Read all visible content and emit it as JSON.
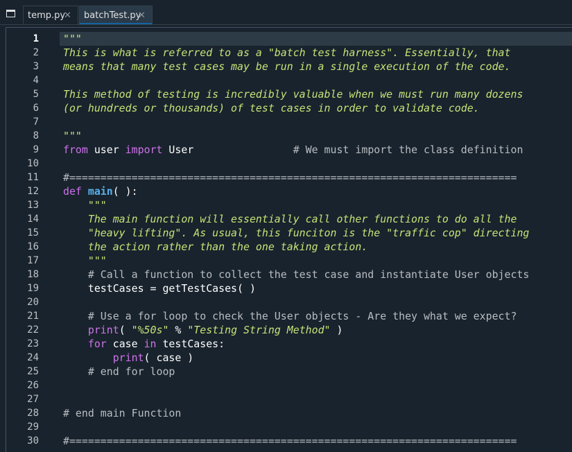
{
  "tabs": [
    {
      "label": "temp.py",
      "close": "✕",
      "active": false
    },
    {
      "label": "batchTest.py",
      "close": "✕",
      "active": true
    }
  ],
  "editor": {
    "current_line": 1,
    "lines": [
      {
        "n": "1",
        "segments": [
          {
            "c": "doc",
            "t": "\"\"\""
          }
        ]
      },
      {
        "n": "2",
        "segments": [
          {
            "c": "doc",
            "t": "This is what is referred to as a \"batch test harness\". Essentially, that"
          }
        ]
      },
      {
        "n": "3",
        "segments": [
          {
            "c": "doc",
            "t": "means that many test cases may be run in a single execution of the code."
          }
        ]
      },
      {
        "n": "4",
        "segments": []
      },
      {
        "n": "5",
        "segments": [
          {
            "c": "doc",
            "t": "This method of testing is incredibly valuable when we must run many dozens"
          }
        ]
      },
      {
        "n": "6",
        "segments": [
          {
            "c": "doc",
            "t": "(or hundreds or thousands) of test cases in order to validate code."
          }
        ]
      },
      {
        "n": "7",
        "segments": []
      },
      {
        "n": "8",
        "segments": [
          {
            "c": "doc",
            "t": "\"\"\""
          }
        ]
      },
      {
        "n": "9",
        "segments": [
          {
            "c": "kw",
            "t": "from"
          },
          {
            "c": "plain",
            "t": " user "
          },
          {
            "c": "kw",
            "t": "import"
          },
          {
            "c": "plain",
            "t": " User                "
          },
          {
            "c": "cm",
            "t": "# We must import the class definition"
          }
        ]
      },
      {
        "n": "10",
        "segments": []
      },
      {
        "n": "11",
        "segments": [
          {
            "c": "cm",
            "t": "#========================================================================"
          }
        ]
      },
      {
        "n": "12",
        "segments": [
          {
            "c": "kw",
            "t": "def"
          },
          {
            "c": "plain",
            "t": " "
          },
          {
            "c": "fn",
            "t": "main"
          },
          {
            "c": "plain",
            "t": "( ):"
          }
        ]
      },
      {
        "n": "13",
        "segments": [
          {
            "c": "doc",
            "t": "    \"\"\""
          }
        ]
      },
      {
        "n": "14",
        "segments": [
          {
            "c": "doc",
            "t": "    The main function will essentially call other functions to do all the"
          }
        ]
      },
      {
        "n": "15",
        "segments": [
          {
            "c": "doc",
            "t": "    \"heavy lifting\". As usual, this funciton is the \"traffic cop\" directing"
          }
        ]
      },
      {
        "n": "16",
        "segments": [
          {
            "c": "doc",
            "t": "    the action rather than the one taking action."
          }
        ]
      },
      {
        "n": "17",
        "segments": [
          {
            "c": "doc",
            "t": "    \"\"\""
          }
        ]
      },
      {
        "n": "18",
        "segments": [
          {
            "c": "cm",
            "t": "    # Call a function to collect the test case and instantiate User objects"
          }
        ]
      },
      {
        "n": "19",
        "segments": [
          {
            "c": "plain",
            "t": "    testCases = getTestCases( )"
          }
        ]
      },
      {
        "n": "20",
        "segments": []
      },
      {
        "n": "21",
        "segments": [
          {
            "c": "cm",
            "t": "    # Use a for loop to check the User objects - Are they what we expect?"
          }
        ]
      },
      {
        "n": "22",
        "segments": [
          {
            "c": "kw",
            "t": "    print"
          },
          {
            "c": "plain",
            "t": "( "
          },
          {
            "c": "str",
            "t": "\"%50s\""
          },
          {
            "c": "plain",
            "t": " % "
          },
          {
            "c": "str",
            "t": "\"Testing String Method\""
          },
          {
            "c": "plain",
            "t": " )"
          }
        ]
      },
      {
        "n": "23",
        "segments": [
          {
            "c": "kw",
            "t": "    for"
          },
          {
            "c": "plain",
            "t": " case "
          },
          {
            "c": "kw",
            "t": "in"
          },
          {
            "c": "plain",
            "t": " testCases:"
          }
        ]
      },
      {
        "n": "24",
        "segments": [
          {
            "c": "kw",
            "t": "        print"
          },
          {
            "c": "plain",
            "t": "( case )"
          }
        ]
      },
      {
        "n": "25",
        "segments": [
          {
            "c": "cm",
            "t": "    # end for loop"
          }
        ]
      },
      {
        "n": "26",
        "segments": []
      },
      {
        "n": "27",
        "segments": []
      },
      {
        "n": "28",
        "segments": [
          {
            "c": "cm",
            "t": "# end main Function"
          }
        ]
      },
      {
        "n": "29",
        "segments": []
      },
      {
        "n": "30",
        "segments": [
          {
            "c": "cm",
            "t": "#========================================================================"
          }
        ]
      }
    ]
  }
}
